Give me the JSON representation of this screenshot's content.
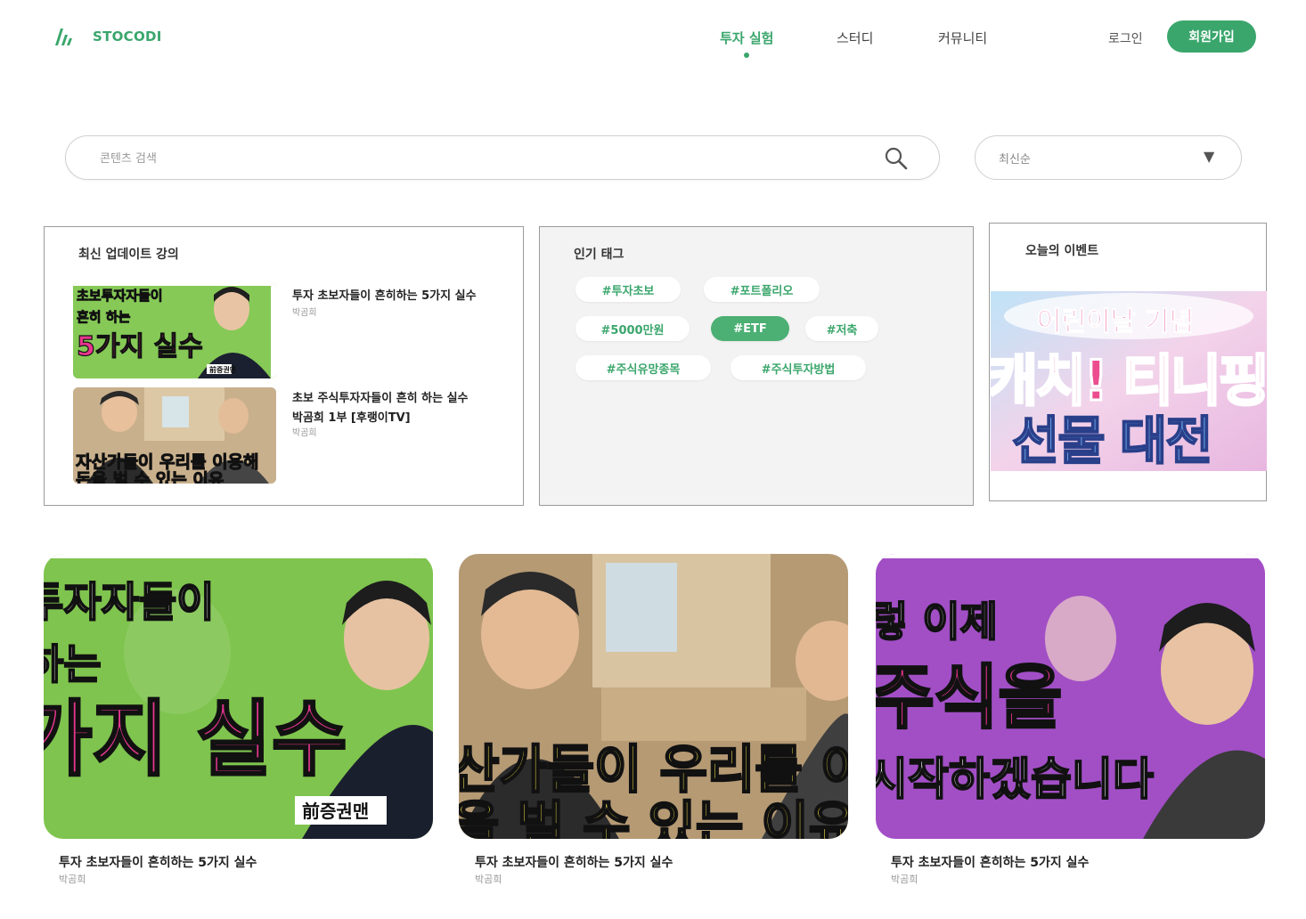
{
  "header": {
    "brand": "STOCODI",
    "nav": [
      {
        "label": "투자 실험",
        "active": true
      },
      {
        "label": "스터디",
        "active": false
      },
      {
        "label": "커뮤니티",
        "active": false
      }
    ],
    "login": "로그인",
    "signup": "회원가입"
  },
  "search": {
    "placeholder": "콘텐츠 검색",
    "icon": "search-icon"
  },
  "sort": {
    "selected": "최신순",
    "icon": "triangle-down-icon"
  },
  "latest": {
    "title": "최신 업데이트 강의",
    "items": [
      {
        "title": "투자 초보자들이 흔히하는 5가지 실수",
        "author": "박곰희",
        "thumb_lines": [
          "초보투자자들이",
          "흔히 하는",
          "5가지 실수"
        ],
        "thumb_badge": "前증권맨"
      },
      {
        "title_line1": "초보 주식투자자들이 흔히 하는 실수",
        "title_line2": "박곰희 1부 [후랭이TV]",
        "author": "박곰희",
        "thumb_lines": [
          "자산가들이 우리를 이용해",
          "돈을 벌 수 있는 이유"
        ]
      }
    ]
  },
  "tags": {
    "title": "인기 태그",
    "items": [
      {
        "label": "#투자초보",
        "active": false
      },
      {
        "label": "#포트폴리오",
        "active": false
      },
      {
        "label": "#5000만원",
        "active": false
      },
      {
        "label": "#ETF",
        "active": true
      },
      {
        "label": "#저축",
        "active": false
      },
      {
        "label": "#주식유망종목",
        "active": false
      },
      {
        "label": "#주식투자방법",
        "active": false
      }
    ]
  },
  "event": {
    "title": "오늘의 이벤트",
    "banner_line1": "어린이날 기념",
    "banner_line2": "캐치! 티니핑",
    "banner_line3": "선물 대전"
  },
  "cards": [
    {
      "title": "투자 초보자들이 흔히하는 5가지 실수",
      "author": "박곰희",
      "thumb_lines": [
        "투자자들이",
        "하는",
        "가지 실수"
      ],
      "thumb_badge": "前증권맨",
      "bg": "#7fc44e"
    },
    {
      "title": "투자 초보자들이 흔히하는 5가지 실수",
      "author": "박곰희",
      "thumb_lines": [
        "산가들이 우리를 이용",
        "을 벌 수 있는 이유"
      ],
      "bg": "#b59a74"
    },
    {
      "title": "투자 초보자들이 흔히하는 5가지 실수",
      "author": "박곰희",
      "thumb_lines": [
        "렇 이제",
        "주식을",
        "시작하겠습니다"
      ],
      "bg": "#a24fc6"
    }
  ]
}
